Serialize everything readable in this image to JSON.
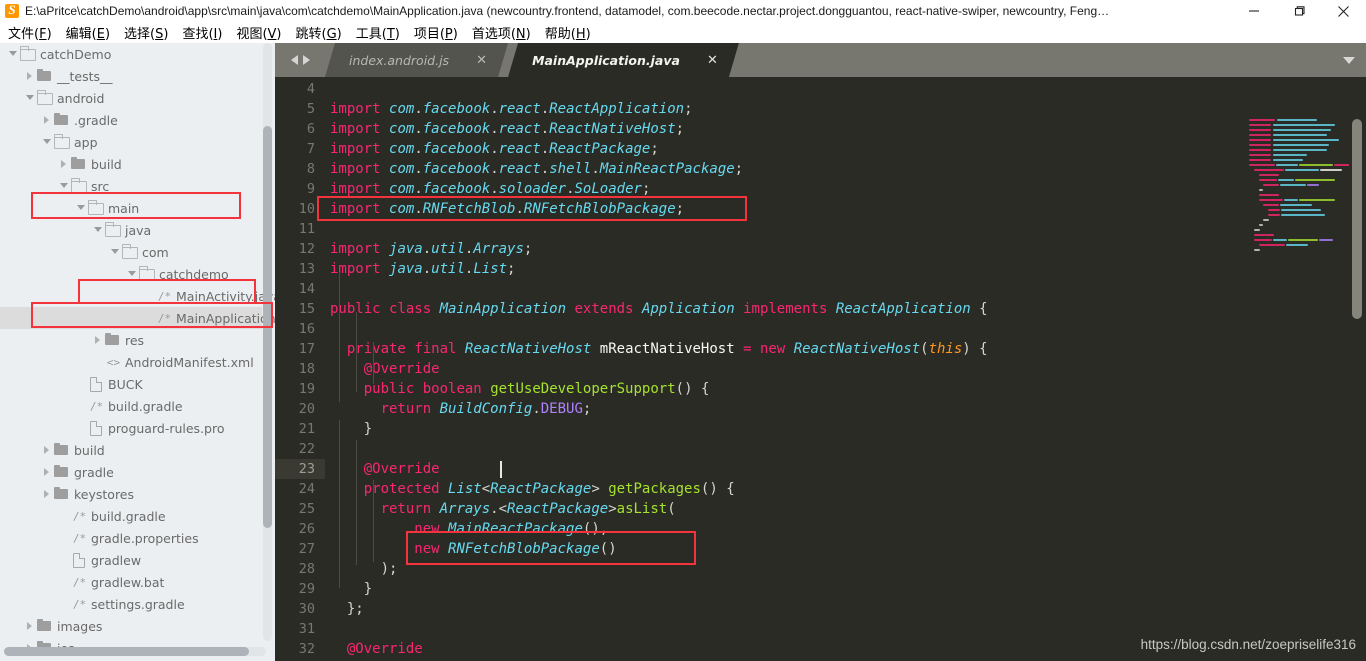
{
  "window": {
    "app_icon": "sublime-text-icon",
    "title": "E:\\aPritce\\catchDemo\\android\\app\\src\\main\\java\\com\\catchdemo\\MainApplication.java (newcountry.frontend, datamodel, com.beecode.nectar.project.dongguantou, react-native-swiper, newcountry, Feng…",
    "controls": {
      "minimize": "minimize-icon",
      "maximize": "maximize-icon",
      "close": "close-icon"
    }
  },
  "menubar": {
    "items": [
      {
        "label": "文件",
        "mnemonic": "F"
      },
      {
        "label": "编辑",
        "mnemonic": "E"
      },
      {
        "label": "选择",
        "mnemonic": "S"
      },
      {
        "label": "查找",
        "mnemonic": "I"
      },
      {
        "label": "视图",
        "mnemonic": "V"
      },
      {
        "label": "跳转",
        "mnemonic": "G"
      },
      {
        "label": "工具",
        "mnemonic": "T"
      },
      {
        "label": "项目",
        "mnemonic": "P"
      },
      {
        "label": "首选项",
        "mnemonic": "N"
      },
      {
        "label": "帮助",
        "mnemonic": "H"
      }
    ]
  },
  "sidebar": {
    "tree": [
      {
        "label": "catchDemo",
        "depth": 0,
        "icon": "folder-open",
        "arrow": "open",
        "selected": false,
        "highlight": false
      },
      {
        "label": "__tests__",
        "depth": 1,
        "icon": "folder-closed",
        "arrow": "closed",
        "selected": false,
        "highlight": false
      },
      {
        "label": "android",
        "depth": 1,
        "icon": "folder-open",
        "arrow": "open",
        "selected": false,
        "highlight": false
      },
      {
        "label": ".gradle",
        "depth": 2,
        "icon": "folder-closed",
        "arrow": "closed",
        "selected": false,
        "highlight": false
      },
      {
        "label": "app",
        "depth": 2,
        "icon": "folder-open",
        "arrow": "open",
        "selected": false,
        "highlight": false
      },
      {
        "label": "build",
        "depth": 3,
        "icon": "folder-closed",
        "arrow": "closed",
        "selected": false,
        "highlight": false
      },
      {
        "label": "src",
        "depth": 3,
        "icon": "folder-open",
        "arrow": "open",
        "selected": false,
        "highlight": false
      },
      {
        "label": "main",
        "depth": 4,
        "icon": "folder-open",
        "arrow": "open",
        "selected": false,
        "highlight": true
      },
      {
        "label": "java",
        "depth": 5,
        "icon": "folder-open",
        "arrow": "open",
        "selected": false,
        "highlight": false
      },
      {
        "label": "com",
        "depth": 6,
        "icon": "folder-open",
        "arrow": "open",
        "selected": false,
        "highlight": false
      },
      {
        "label": "catchdemo",
        "depth": 7,
        "icon": "folder-open",
        "arrow": "open",
        "selected": false,
        "highlight": false
      },
      {
        "label": "MainActivity.java",
        "depth": 8,
        "icon": "file-code",
        "arrow": "none",
        "selected": false,
        "highlight": true
      },
      {
        "label": "MainApplication.java",
        "depth": 8,
        "icon": "file-code",
        "arrow": "none",
        "selected": true,
        "highlight": true
      },
      {
        "label": "res",
        "depth": 5,
        "icon": "folder-closed",
        "arrow": "closed",
        "selected": false,
        "highlight": false
      },
      {
        "label": "AndroidManifest.xml",
        "depth": 5,
        "icon": "file-xml",
        "arrow": "none",
        "selected": false,
        "highlight": false
      },
      {
        "label": "BUCK",
        "depth": 4,
        "icon": "file-doc",
        "arrow": "none",
        "selected": false,
        "highlight": false
      },
      {
        "label": "build.gradle",
        "depth": 4,
        "icon": "file-code",
        "arrow": "none",
        "selected": false,
        "highlight": false
      },
      {
        "label": "proguard-rules.pro",
        "depth": 4,
        "icon": "file-doc",
        "arrow": "none",
        "selected": false,
        "highlight": false
      },
      {
        "label": "build",
        "depth": 2,
        "icon": "folder-closed",
        "arrow": "closed",
        "selected": false,
        "highlight": false
      },
      {
        "label": "gradle",
        "depth": 2,
        "icon": "folder-closed",
        "arrow": "closed",
        "selected": false,
        "highlight": false
      },
      {
        "label": "keystores",
        "depth": 2,
        "icon": "folder-closed",
        "arrow": "closed",
        "selected": false,
        "highlight": false
      },
      {
        "label": "build.gradle",
        "depth": 3,
        "icon": "file-code",
        "arrow": "none",
        "selected": false,
        "highlight": false
      },
      {
        "label": "gradle.properties",
        "depth": 3,
        "icon": "file-code",
        "arrow": "none",
        "selected": false,
        "highlight": false
      },
      {
        "label": "gradlew",
        "depth": 3,
        "icon": "file-doc",
        "arrow": "none",
        "selected": false,
        "highlight": false
      },
      {
        "label": "gradlew.bat",
        "depth": 3,
        "icon": "file-code",
        "arrow": "none",
        "selected": false,
        "highlight": false
      },
      {
        "label": "settings.gradle",
        "depth": 3,
        "icon": "file-code",
        "arrow": "none",
        "selected": false,
        "highlight": false
      },
      {
        "label": "images",
        "depth": 1,
        "icon": "folder-closed",
        "arrow": "closed",
        "selected": false,
        "highlight": false
      },
      {
        "label": "ios",
        "depth": 1,
        "icon": "folder-closed",
        "arrow": "closed",
        "selected": false,
        "highlight": false
      }
    ]
  },
  "editor": {
    "nav": {
      "back": "arrow-left-icon",
      "forward": "arrow-right-icon"
    },
    "tabs_menu_icon": "chevron-down-icon",
    "tabs": [
      {
        "label": "index.android.js",
        "active": false,
        "close_icon": "close-icon"
      },
      {
        "label": "MainApplication.java",
        "active": true,
        "close_icon": "close-icon"
      }
    ],
    "first_visible_line": 4,
    "active_line": 23,
    "lines": [
      {
        "n": 4,
        "text": ""
      },
      {
        "n": 5,
        "text": "import com.facebook.react.ReactApplication;"
      },
      {
        "n": 6,
        "text": "import com.facebook.react.ReactNativeHost;"
      },
      {
        "n": 7,
        "text": "import com.facebook.react.ReactPackage;"
      },
      {
        "n": 8,
        "text": "import com.facebook.react.shell.MainReactPackage;"
      },
      {
        "n": 9,
        "text": "import com.facebook.soloader.SoLoader;"
      },
      {
        "n": 10,
        "text": "import com.RNFetchBlob.RNFetchBlobPackage;"
      },
      {
        "n": 11,
        "text": ""
      },
      {
        "n": 12,
        "text": "import java.util.Arrays;"
      },
      {
        "n": 13,
        "text": "import java.util.List;"
      },
      {
        "n": 14,
        "text": ""
      },
      {
        "n": 15,
        "text": "public class MainApplication extends Application implements ReactApplication {"
      },
      {
        "n": 16,
        "text": ""
      },
      {
        "n": 17,
        "text": "  private final ReactNativeHost mReactNativeHost = new ReactNativeHost(this) {"
      },
      {
        "n": 18,
        "text": "    @Override"
      },
      {
        "n": 19,
        "text": "    public boolean getUseDeveloperSupport() {"
      },
      {
        "n": 20,
        "text": "      return BuildConfig.DEBUG;"
      },
      {
        "n": 21,
        "text": "    }"
      },
      {
        "n": 22,
        "text": ""
      },
      {
        "n": 23,
        "text": "    @Override"
      },
      {
        "n": 24,
        "text": "    protected List<ReactPackage> getPackages() {"
      },
      {
        "n": 25,
        "text": "      return Arrays.<ReactPackage>asList("
      },
      {
        "n": 26,
        "text": "          new MainReactPackage(),"
      },
      {
        "n": 27,
        "text": "          new RNFetchBlobPackage()"
      },
      {
        "n": 28,
        "text": "      );"
      },
      {
        "n": 29,
        "text": "    }"
      },
      {
        "n": 30,
        "text": "  };"
      },
      {
        "n": 31,
        "text": ""
      },
      {
        "n": 32,
        "text": "  @Override"
      }
    ],
    "annotations": [
      {
        "name": "highlight-import-rnfetchblob",
        "target_line": 10
      },
      {
        "name": "highlight-new-rnfetchblobpackage",
        "target_line": 27
      }
    ]
  },
  "watermark": {
    "text": "https://blog.csdn.net/zoepriselife316"
  },
  "colors": {
    "annotation_red": "#f4333c",
    "editor_background": "#2b2b26",
    "tabstrip_background": "#77776f",
    "sidebar_background": "#eceff1",
    "keyword": "#f92672",
    "type": "#66d9ef",
    "function": "#a6e22e",
    "constant": "#ae81ff",
    "parameter": "#fd971f",
    "app_accent": "#ff9800"
  }
}
